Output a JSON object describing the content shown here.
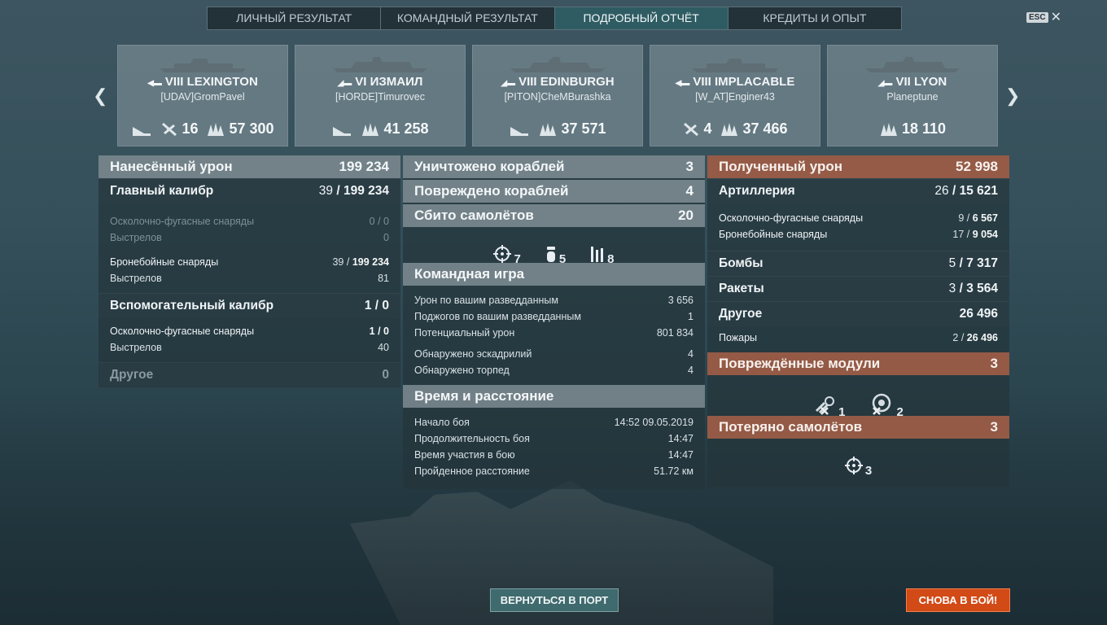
{
  "tabs": [
    {
      "label": "ЛИЧНЫЙ РЕЗУЛЬТАТ"
    },
    {
      "label": "КОМАНДНЫЙ РЕЗУЛЬТАТ"
    },
    {
      "label": "ПОДРОБНЫЙ ОТЧЁТ"
    },
    {
      "label": "КРЕДИТЫ И ОПЫТ"
    }
  ],
  "esc_label": "ESC",
  "ships": [
    {
      "tier_name": "VIII LEXINGTON",
      "player": "[UDAV]GromPavel",
      "planes": "16",
      "damage": "57 300"
    },
    {
      "tier_name": "VI ИЗМАИЛ",
      "player": "[HORDE]Timurovec",
      "damage": "41 258"
    },
    {
      "tier_name": "VIII EDINBURGH",
      "player": "[PITON]CheMBurashka",
      "damage": "37 571"
    },
    {
      "tier_name": "VIII IMPLACABLE",
      "player": "[W_AT]Enginer43",
      "planes": "4",
      "damage": "37 466"
    },
    {
      "tier_name": "VII LYON",
      "player": "Planeptune",
      "damage": "18 110"
    }
  ],
  "dealt": {
    "title": "Нанесённый урон",
    "total": "199 234",
    "main": {
      "label": "Главный калибр",
      "hits": "39",
      "value": "199 234"
    },
    "he_label": "Осколочно-фугасные снаряды",
    "he_value": "0 / 0",
    "shots_label": "Выстрелов",
    "he_shots": "0",
    "ap_label": "Бронебойные снаряды",
    "ap_hits": "39",
    "ap_value": "199 234",
    "ap_shots": "81",
    "secondary": {
      "label": "Вспомогательный калибр",
      "value": "1 / 0"
    },
    "sec_he_label": "Осколочно-фугасные снаряды",
    "sec_he_value": "1 / 0",
    "sec_shots": "40",
    "other": {
      "label": "Другое",
      "value": "0"
    }
  },
  "middle": {
    "destroyed": {
      "label": "Уничтожено кораблей",
      "value": "3"
    },
    "damaged": {
      "label": "Повреждено кораблей",
      "value": "4"
    },
    "planes": {
      "label": "Сбито самолётов",
      "value": "20",
      "fighters": "7",
      "bombers": "5",
      "torp": "8"
    },
    "team": {
      "title": "Командная игра",
      "rows": [
        {
          "label": "Урон по вашим разведданным",
          "value": "3 656"
        },
        {
          "label": "Поджогов по вашим разведданным",
          "value": "1"
        },
        {
          "label": "Потенциальный урон",
          "value": "801 834"
        },
        {
          "label": "Обнаружено эскадрилий",
          "value": "4"
        },
        {
          "label": "Обнаружено торпед",
          "value": "4"
        }
      ]
    },
    "time": {
      "title": "Время и расстояние",
      "rows": [
        {
          "label": "Начало боя",
          "value": "14:52  09.05.2019"
        },
        {
          "label": "Продолжительность боя",
          "value": "14:47"
        },
        {
          "label": "Время участия в бою",
          "value": "14:47"
        },
        {
          "label": "Пройденное расстояние",
          "value": "51.72 км"
        }
      ]
    }
  },
  "received": {
    "title": "Полученный урон",
    "total": "52 998",
    "art": {
      "label": "Артиллерия",
      "hits": "26",
      "value": "15 621"
    },
    "he_label": "Осколочно-фугасные снаряды",
    "he_hits": "9",
    "he_value": "6 567",
    "ap_label": "Бронебойные снаряды",
    "ap_hits": "17",
    "ap_value": "9 054",
    "bombs": {
      "label": "Бомбы",
      "hits": "5",
      "value": "7 317"
    },
    "rockets": {
      "label": "Ракеты",
      "hits": "3",
      "value": "3 564"
    },
    "other": {
      "label": "Другое",
      "value": "26 496"
    },
    "fires_label": "Пожары",
    "fires_hits": "2",
    "fires_value": "26 496",
    "modules": {
      "title": "Повреждённые модули",
      "value": "3",
      "m1": "1",
      "m2": "2"
    },
    "lost": {
      "title": "Потеряно самолётов",
      "value": "3",
      "fighters": "3"
    }
  },
  "buttons": {
    "port": "ВЕРНУТЬСЯ В ПОРТ",
    "battle": "СНОВА В БОЙ!"
  },
  "colors": {
    "accent_tab": "#2f5c63",
    "received_header": "#a86048",
    "battle_button": "#d24a16"
  }
}
